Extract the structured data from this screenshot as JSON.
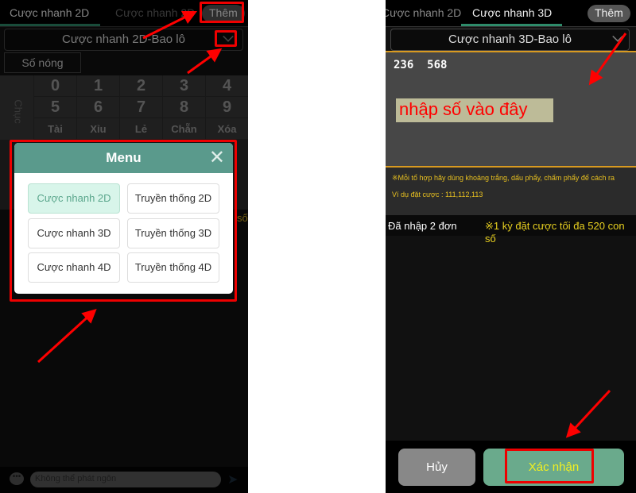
{
  "left": {
    "tabs": [
      "Cược nhanh 2D",
      "Cược nhanh 2D"
    ],
    "more_label": "Thêm",
    "dropdown": "Cược nhanh 2D-Bao lô",
    "hot_numbers": "Số nóng",
    "keypad": {
      "row_label": "Chục",
      "digits": [
        "0",
        "1",
        "2",
        "3",
        "4",
        "5",
        "6",
        "7",
        "8",
        "9"
      ],
      "actions": [
        "Tài",
        "Xỉu",
        "Lẻ",
        "Chẵn",
        "Xóa"
      ]
    },
    "partial_text": "số",
    "menu": {
      "title": "Menu",
      "items": [
        "Cược nhanh 2D",
        "Truyền thống 2D",
        "Cược nhanh 3D",
        "Truyền thống 3D",
        "Cược nhanh 4D",
        "Truyền thống 4D"
      ],
      "selected": "Cược nhanh 2D"
    },
    "chat_placeholder": "Không thể phát ngôn"
  },
  "right": {
    "tabs": [
      "Cược nhanh 2D",
      "Cược nhanh 3D"
    ],
    "more_label": "Thêm",
    "dropdown": "Cược nhanh 3D-Bao lô",
    "input_value": "236  568",
    "annotation": "nhập số vào đây",
    "hint_line1": "※Mỗi tổ hợp hãy dùng khoảng trắng, dấu phẩy, chấm phẩy để cách ra",
    "hint_line2": "Ví dụ đặt cược : 111,112,113",
    "entered_count": "Đã nhập 2 đơn",
    "limit_note": "※1 kỳ đặt cược tối đa 520 con số",
    "cancel": "Hủy",
    "confirm": "Xác nhận"
  },
  "colors": {
    "accent": "#5a9a8c",
    "highlight": "#e00000",
    "hint": "#e8c020"
  }
}
